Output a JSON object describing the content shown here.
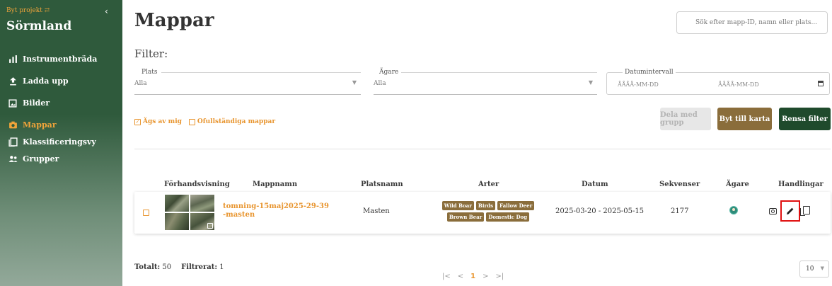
{
  "sidebar": {
    "switch_project": "Byt projekt",
    "region": "Sörmland",
    "items": [
      {
        "label": "Instrumentbräda",
        "icon": "bar-chart-icon"
      },
      {
        "label": "Ladda upp",
        "icon": "upload-icon"
      },
      {
        "label": "Bilder",
        "icon": "images-icon"
      },
      {
        "label": "Mappar",
        "icon": "camera-icon",
        "active": true
      },
      {
        "label": "Klassificeringsvy",
        "icon": "classification-icon"
      },
      {
        "label": "Grupper",
        "icon": "group-icon"
      }
    ]
  },
  "header": {
    "title": "Mappar",
    "search_placeholder": "Sök efter mapp-ID, namn eller plats..."
  },
  "filter": {
    "label": "Filter:",
    "place": {
      "legend": "Plats",
      "value": "Alla"
    },
    "owner": {
      "legend": "Ägare",
      "value": "Alla"
    },
    "date_range": {
      "legend": "Datumintervall",
      "start_placeholder": "ÅÅÅÅ-MM-DD",
      "end_placeholder": "ÅÅÅÅ-MM-DD"
    },
    "owned_by_me": {
      "label": "Ägs av mig",
      "checked": true
    },
    "incomplete": {
      "label": "Ofullständiga mappar",
      "checked": false
    }
  },
  "buttons": {
    "share": "Dela med grupp",
    "map": "Byt till karta",
    "clear": "Rensa filter"
  },
  "table": {
    "headers": {
      "preview": "Förhandsvisning",
      "name": "Mappnamn",
      "place": "Platsnamn",
      "species": "Arter",
      "date": "Datum",
      "sequences": "Sekvenser",
      "owner": "Ägare",
      "actions": "Handlingar"
    },
    "rows": [
      {
        "name": "tomning-15maj2025-29-39-masten",
        "place": "Masten",
        "species": [
          "Wild Boar",
          "Birds",
          "Fallow Deer",
          "Brown Bear",
          "Domestic Dog"
        ],
        "date": "2025-03-20 - 2025-05-15",
        "sequences": "2177"
      }
    ]
  },
  "footer": {
    "total_label": "Totalt:",
    "total_value": "50",
    "filtered_label": "Filtrerat:",
    "filtered_value": "1",
    "current_page": "1",
    "per_page": "10"
  },
  "colors": {
    "sidebar": "#2f5a3c",
    "accent": "#e8952f",
    "brown": "#8a6d3b",
    "dark_green": "#1f4a2c",
    "highlight": "#e01010"
  }
}
